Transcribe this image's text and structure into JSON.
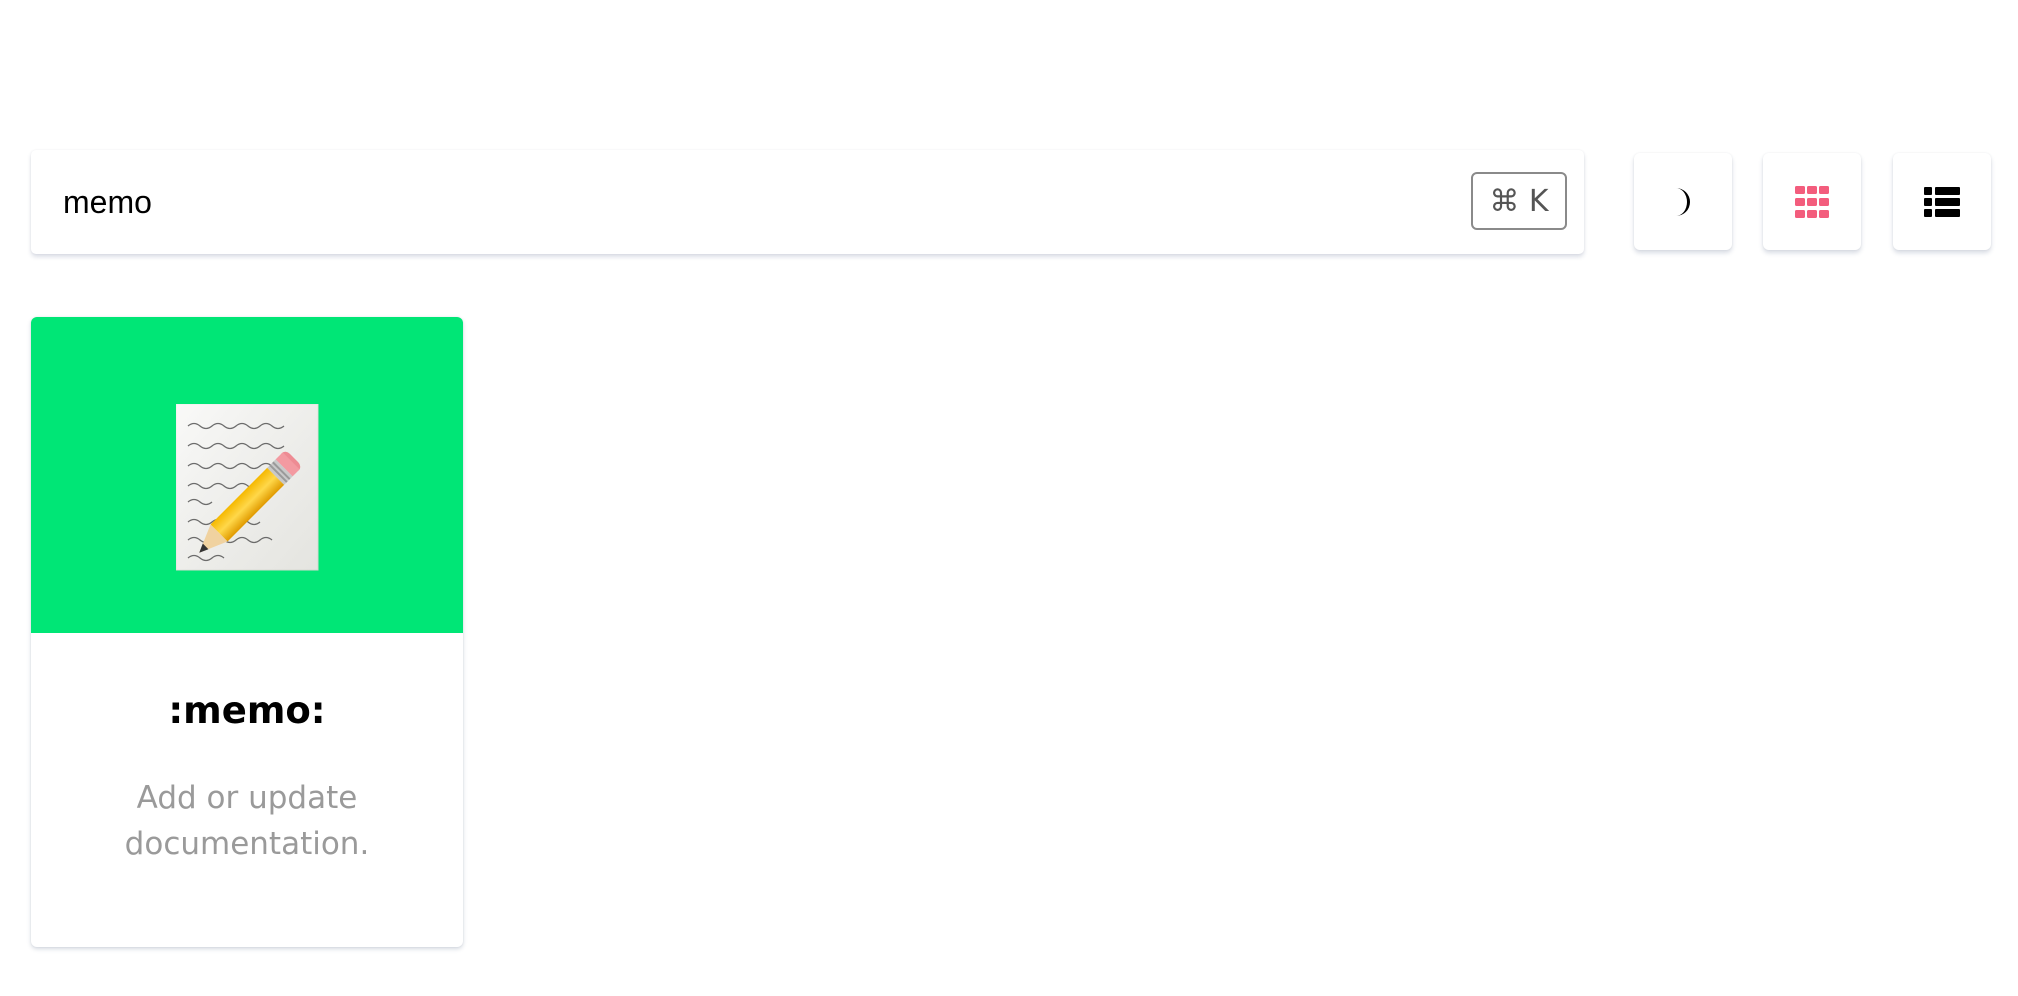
{
  "search": {
    "value": "memo",
    "shortcut": "⌘ K"
  },
  "toolbar": {
    "buttons": [
      {
        "icon": "moon-icon",
        "active": false
      },
      {
        "icon": "grid-icon",
        "active": true
      },
      {
        "icon": "list-icon",
        "active": false
      }
    ],
    "active_color": "#f35d7d"
  },
  "results": [
    {
      "code": ":memo:",
      "description": "Add or update documentation.",
      "icon": "memo-emoji",
      "color": "#00e676"
    }
  ]
}
